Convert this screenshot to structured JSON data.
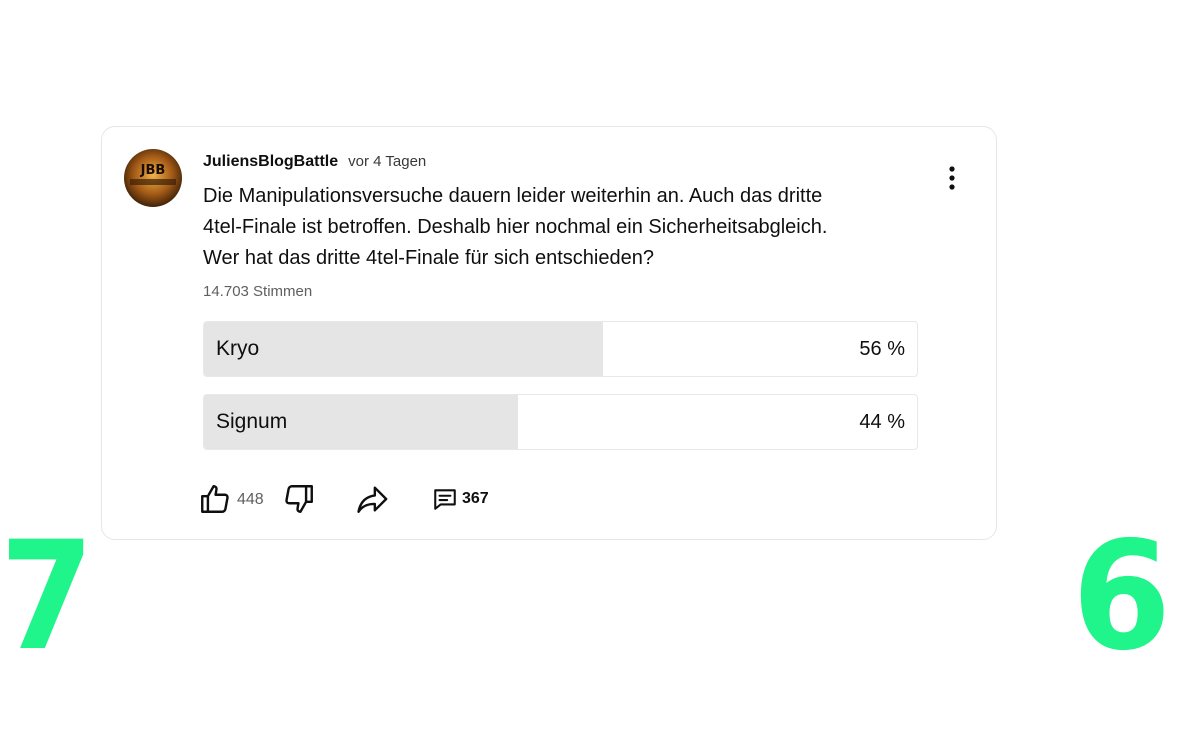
{
  "post": {
    "avatar_text": "JBB",
    "channel_name": "JuliensBlogBattle",
    "time": "vor 4 Tagen",
    "text": "Die Manipulationsversuche dauern leider weiterhin an. Auch das dritte\n4tel-Finale ist betroffen. Deshalb hier nochmal ein Sicherheitsabgleich.\nWer hat das dritte 4tel-Finale für sich entschieden?",
    "vote_count": "14.703 Stimmen"
  },
  "poll": {
    "options": [
      {
        "label": "Kryo",
        "percent_text": "56 %",
        "fraction": 0.56
      },
      {
        "label": "Signum",
        "percent_text": "44 %",
        "fraction": 0.44
      }
    ]
  },
  "actions": {
    "like_icon": "thumbs-up-icon",
    "like_count": "448",
    "dislike_icon": "thumbs-down-icon",
    "share_icon": "share-icon",
    "comment_icon": "comment-icon",
    "comment_count": "367",
    "menu_icon": "more-vertical-icon"
  },
  "overlay": {
    "left_digit": "7",
    "right_digit": "6",
    "digit_color": "#1ff58a"
  }
}
